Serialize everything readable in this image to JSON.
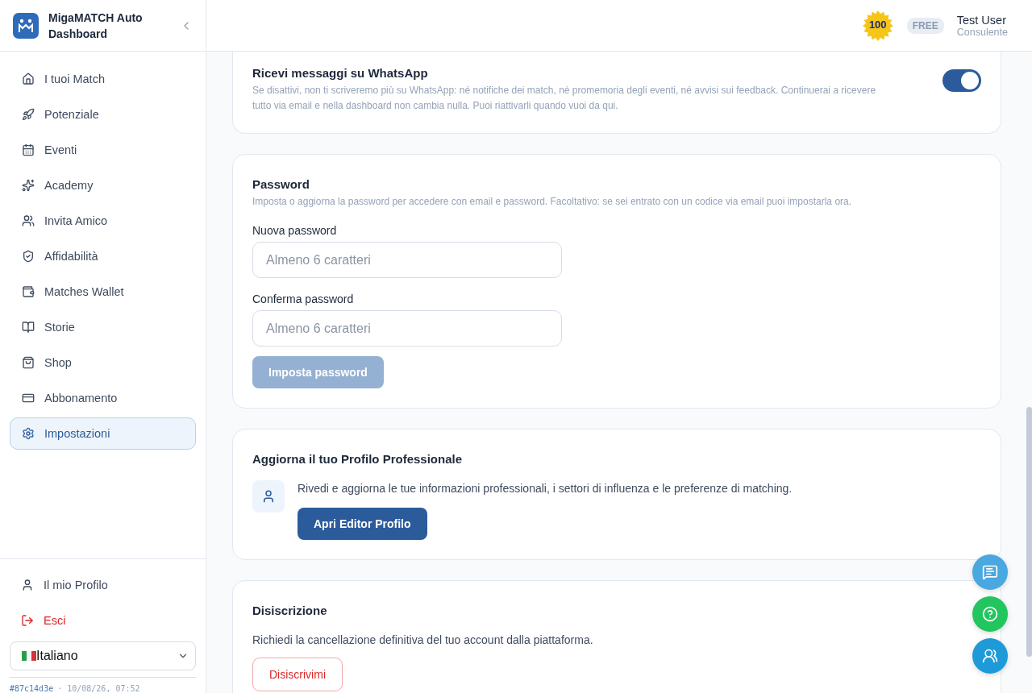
{
  "sidebar": {
    "brand": "MigaMATCH Auto Dashboard",
    "items": [
      {
        "label": "I tuoi Match",
        "selected": false
      },
      {
        "label": "Potenziale",
        "selected": false
      },
      {
        "label": "Eventi",
        "selected": false
      },
      {
        "label": "Academy",
        "selected": false
      },
      {
        "label": "Invita Amico",
        "selected": false
      },
      {
        "label": "Affidabilità",
        "selected": false
      },
      {
        "label": "Matches Wallet",
        "selected": false
      },
      {
        "label": "Storie",
        "selected": false
      },
      {
        "label": "Shop",
        "selected": false
      },
      {
        "label": "Abbonamento",
        "selected": false
      },
      {
        "label": "Impostazioni",
        "selected": true
      }
    ],
    "bottom_items": [
      {
        "label": "Il mio Profilo",
        "kind": "normal"
      },
      {
        "label": "Esci",
        "kind": "danger"
      }
    ],
    "language": {
      "value": "Italiano"
    },
    "build": {
      "hash": "#87c14d3e",
      "timestamp": "· 10/08/26, 07:52"
    }
  },
  "header": {
    "points": "100",
    "plan": "FREE",
    "user_name": "Test User",
    "user_role": "Consulente"
  },
  "whatsapp": {
    "title": "Ricevi messaggi su WhatsApp",
    "description": "Se disattivi, non ti scriveremo più su WhatsApp: né notifiche dei match, né promemoria degli eventi, né avvisi sui feedback. Continuerai a ricevere tutto via email e nella dashboard non cambia nulla. Puoi riattivarli quando vuoi da qui.",
    "on": true
  },
  "password": {
    "title": "Password",
    "description": "Imposta o aggiorna la password per accedere con email e password. Facoltativo: se sei entrato con un codice via email puoi impostarla ora.",
    "fields": [
      {
        "label": "Nuova password",
        "placeholder": "Almeno 6 caratteri"
      },
      {
        "label": "Conferma password",
        "placeholder": "Almeno 6 caratteri"
      }
    ],
    "button": {
      "label": "Imposta password",
      "disabled": true
    }
  },
  "profile": {
    "title": "Aggiorna il tuo Profilo Professionale",
    "description": "Rivedi e aggiorna le tue informazioni professionali, i settori di influenza e le preferenze di matching.",
    "button": "Apri Editor Profilo"
  },
  "unsubscribe": {
    "title": "Disiscrizione",
    "description": "Richiedi la cancellazione definitiva del tuo account dalla piattaforma.",
    "button": "Disiscrivimi"
  }
}
